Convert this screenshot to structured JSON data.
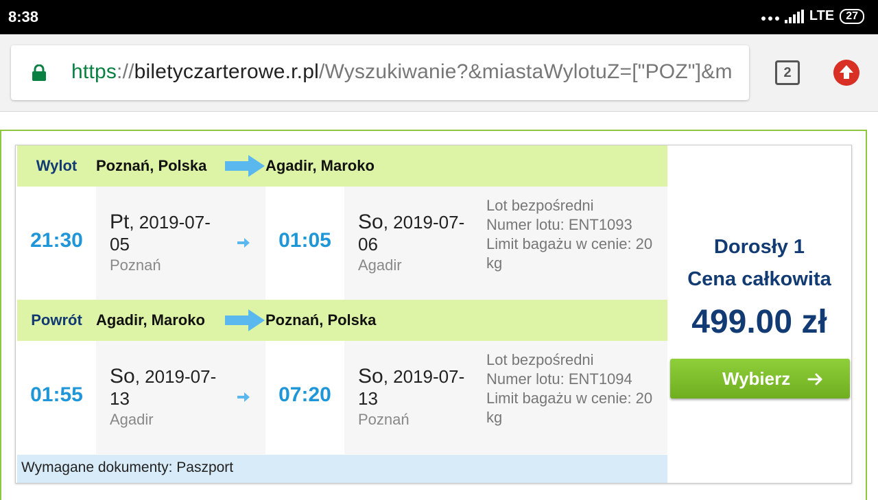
{
  "status_bar": {
    "time": "8:38",
    "network": "LTE",
    "battery": "27"
  },
  "browser": {
    "url_scheme": "https",
    "url_sep": "://",
    "url_host": "biletyczarterowe.r.pl",
    "url_path": "/Wyszukiwanie?&miastaWylotuZ=[\"POZ\"]&m",
    "tab_count": "2"
  },
  "outbound": {
    "label": "Wylot",
    "from": "Poznań, Polska",
    "to": "Agadir, Maroko",
    "depart_time": "21:30",
    "depart_day": "Pt",
    "depart_date": ", 2019-07-05",
    "depart_city": "Poznań",
    "arrive_time": "01:05",
    "arrive_day": "So",
    "arrive_date": ", 2019-07-06",
    "arrive_city": "Agadir",
    "info": [
      "Lot bezpośredni",
      "Numer lotu: ENT1093",
      "Limit bagażu w cenie: 20 kg"
    ]
  },
  "return": {
    "label": "Powrót",
    "from": "Agadir, Maroko",
    "to": "Poznań, Polska",
    "depart_time": "01:55",
    "depart_day": "So",
    "depart_date": ", 2019-07-13",
    "depart_city": "Agadir",
    "arrive_time": "07:20",
    "arrive_day": "So",
    "arrive_date": ", 2019-07-13",
    "arrive_city": "Poznań",
    "info": [
      "Lot bezpośredni",
      "Numer lotu: ENT1094",
      "Limit bagażu w cenie: 20 kg"
    ]
  },
  "documents": "Wymagane dokumenty: Paszport",
  "price_box": {
    "adults": "Dorosły 1",
    "total_label": "Cena całkowita",
    "total": "499.00 zł",
    "select_button": "Wybierz"
  },
  "colors": {
    "header_green": "#ddf3a6",
    "time_blue": "#1f96d8",
    "navy": "#123a73",
    "button_green": "#7cbf2a",
    "arrow_blue": "#5ab8ee",
    "docs_blue": "#d8ebf8"
  },
  "icons": [
    "lock-icon",
    "tab-switcher-icon",
    "upload-icon",
    "route-arrow-icon",
    "small-arrow-icon",
    "chevron-right-icon"
  ]
}
